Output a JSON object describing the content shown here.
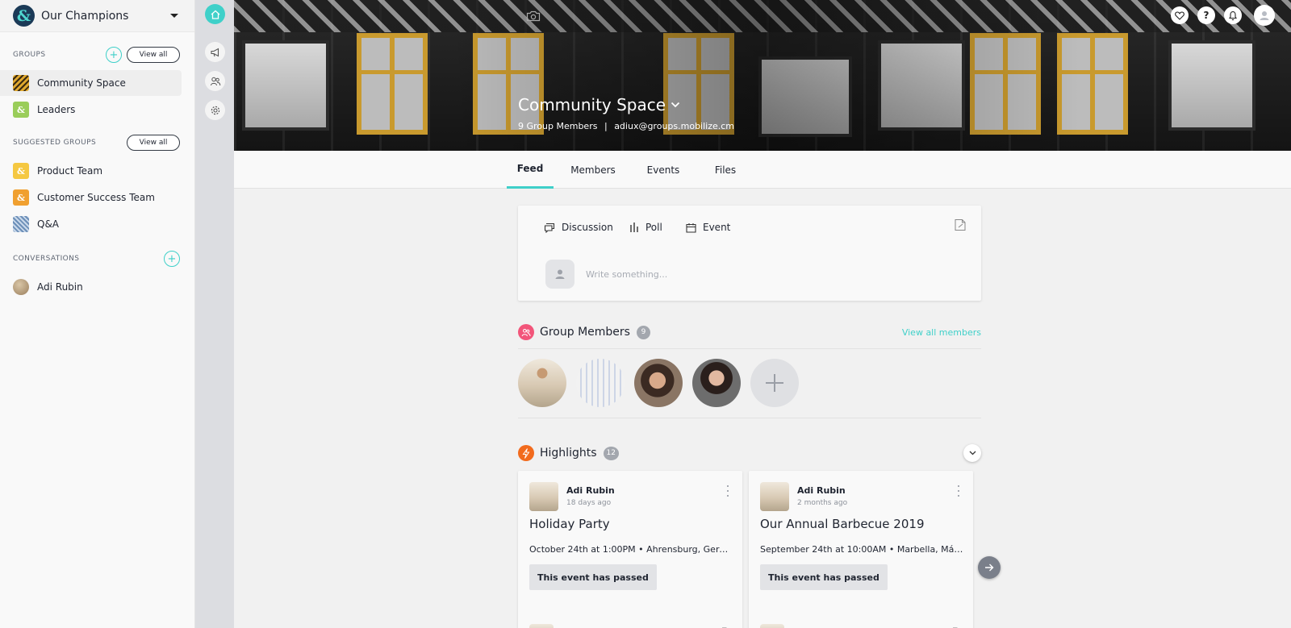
{
  "org": {
    "name": "Our Champions"
  },
  "sidebar": {
    "groups_label": "GROUPS",
    "view_all": "View all",
    "groups": [
      {
        "label": "Community Space",
        "icon": "striped-tile-icon",
        "color": "#e0a82e"
      },
      {
        "label": "Leaders",
        "icon": "ampersand-icon",
        "color": "#9acd5a"
      }
    ],
    "suggested_label": "SUGGESTED GROUPS",
    "suggested": [
      {
        "label": "Product Team",
        "icon": "ampersand-icon",
        "color": "#f5c842"
      },
      {
        "label": "Customer Success Team",
        "icon": "ampersand-icon",
        "color": "#f0a030"
      },
      {
        "label": "Q&A",
        "icon": "pattern-tile-icon",
        "color": "#6c8fb8"
      }
    ],
    "conversations_label": "CONVERSATIONS",
    "conversations": [
      {
        "label": "Adi Rubin"
      }
    ]
  },
  "header": {
    "title": "Community Space",
    "members_count_text": "9 Group Members",
    "email": "adiux@groups.mobilize.cm",
    "separator": "|",
    "help_glyph": "?"
  },
  "tabs": [
    {
      "label": "Feed",
      "active": true
    },
    {
      "label": "Members",
      "active": false
    },
    {
      "label": "Events",
      "active": false
    },
    {
      "label": "Files",
      "active": false
    }
  ],
  "composer": {
    "types": [
      {
        "label": "Discussion",
        "icon": "discussion-icon"
      },
      {
        "label": "Poll",
        "icon": "poll-icon"
      },
      {
        "label": "Event",
        "icon": "calendar-icon"
      }
    ],
    "placeholder": "Write something..."
  },
  "members": {
    "title": "Group Members",
    "count": "9",
    "view_all": "View all members",
    "accent": "#f2557a"
  },
  "highlights": {
    "title": "Highlights",
    "count": "12",
    "accent": "#f26b1d",
    "cards": [
      {
        "author": "Adi Rubin",
        "time": "18 days ago",
        "title": "Holiday Party",
        "meta": "October 24th at 1:00PM • Ahrensburg, Germ...",
        "status": "This event has passed"
      },
      {
        "author": "Adi Rubin",
        "time": "2 months ago",
        "title": "Our Annual Barbecue 2019",
        "meta": "September 24th at 10:00AM • Marbella, Mála...",
        "status": "This event has passed"
      }
    ]
  },
  "colors": {
    "accent": "#3fd0c9",
    "brand_dark": "#1b3a57"
  }
}
